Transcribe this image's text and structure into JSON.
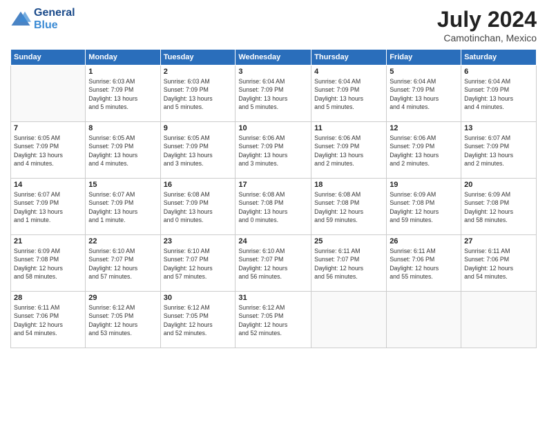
{
  "header": {
    "logo_line1": "General",
    "logo_line2": "Blue",
    "month_year": "July 2024",
    "location": "Camotinchan, Mexico"
  },
  "days_of_week": [
    "Sunday",
    "Monday",
    "Tuesday",
    "Wednesday",
    "Thursday",
    "Friday",
    "Saturday"
  ],
  "weeks": [
    [
      {
        "day": "",
        "info": ""
      },
      {
        "day": "1",
        "info": "Sunrise: 6:03 AM\nSunset: 7:09 PM\nDaylight: 13 hours\nand 5 minutes."
      },
      {
        "day": "2",
        "info": "Sunrise: 6:03 AM\nSunset: 7:09 PM\nDaylight: 13 hours\nand 5 minutes."
      },
      {
        "day": "3",
        "info": "Sunrise: 6:04 AM\nSunset: 7:09 PM\nDaylight: 13 hours\nand 5 minutes."
      },
      {
        "day": "4",
        "info": "Sunrise: 6:04 AM\nSunset: 7:09 PM\nDaylight: 13 hours\nand 5 minutes."
      },
      {
        "day": "5",
        "info": "Sunrise: 6:04 AM\nSunset: 7:09 PM\nDaylight: 13 hours\nand 4 minutes."
      },
      {
        "day": "6",
        "info": "Sunrise: 6:04 AM\nSunset: 7:09 PM\nDaylight: 13 hours\nand 4 minutes."
      }
    ],
    [
      {
        "day": "7",
        "info": "Sunrise: 6:05 AM\nSunset: 7:09 PM\nDaylight: 13 hours\nand 4 minutes."
      },
      {
        "day": "8",
        "info": "Sunrise: 6:05 AM\nSunset: 7:09 PM\nDaylight: 13 hours\nand 4 minutes."
      },
      {
        "day": "9",
        "info": "Sunrise: 6:05 AM\nSunset: 7:09 PM\nDaylight: 13 hours\nand 3 minutes."
      },
      {
        "day": "10",
        "info": "Sunrise: 6:06 AM\nSunset: 7:09 PM\nDaylight: 13 hours\nand 3 minutes."
      },
      {
        "day": "11",
        "info": "Sunrise: 6:06 AM\nSunset: 7:09 PM\nDaylight: 13 hours\nand 2 minutes."
      },
      {
        "day": "12",
        "info": "Sunrise: 6:06 AM\nSunset: 7:09 PM\nDaylight: 13 hours\nand 2 minutes."
      },
      {
        "day": "13",
        "info": "Sunrise: 6:07 AM\nSunset: 7:09 PM\nDaylight: 13 hours\nand 2 minutes."
      }
    ],
    [
      {
        "day": "14",
        "info": "Sunrise: 6:07 AM\nSunset: 7:09 PM\nDaylight: 13 hours\nand 1 minute."
      },
      {
        "day": "15",
        "info": "Sunrise: 6:07 AM\nSunset: 7:09 PM\nDaylight: 13 hours\nand 1 minute."
      },
      {
        "day": "16",
        "info": "Sunrise: 6:08 AM\nSunset: 7:09 PM\nDaylight: 13 hours\nand 0 minutes."
      },
      {
        "day": "17",
        "info": "Sunrise: 6:08 AM\nSunset: 7:08 PM\nDaylight: 13 hours\nand 0 minutes."
      },
      {
        "day": "18",
        "info": "Sunrise: 6:08 AM\nSunset: 7:08 PM\nDaylight: 12 hours\nand 59 minutes."
      },
      {
        "day": "19",
        "info": "Sunrise: 6:09 AM\nSunset: 7:08 PM\nDaylight: 12 hours\nand 59 minutes."
      },
      {
        "day": "20",
        "info": "Sunrise: 6:09 AM\nSunset: 7:08 PM\nDaylight: 12 hours\nand 58 minutes."
      }
    ],
    [
      {
        "day": "21",
        "info": "Sunrise: 6:09 AM\nSunset: 7:08 PM\nDaylight: 12 hours\nand 58 minutes."
      },
      {
        "day": "22",
        "info": "Sunrise: 6:10 AM\nSunset: 7:07 PM\nDaylight: 12 hours\nand 57 minutes."
      },
      {
        "day": "23",
        "info": "Sunrise: 6:10 AM\nSunset: 7:07 PM\nDaylight: 12 hours\nand 57 minutes."
      },
      {
        "day": "24",
        "info": "Sunrise: 6:10 AM\nSunset: 7:07 PM\nDaylight: 12 hours\nand 56 minutes."
      },
      {
        "day": "25",
        "info": "Sunrise: 6:11 AM\nSunset: 7:07 PM\nDaylight: 12 hours\nand 56 minutes."
      },
      {
        "day": "26",
        "info": "Sunrise: 6:11 AM\nSunset: 7:06 PM\nDaylight: 12 hours\nand 55 minutes."
      },
      {
        "day": "27",
        "info": "Sunrise: 6:11 AM\nSunset: 7:06 PM\nDaylight: 12 hours\nand 54 minutes."
      }
    ],
    [
      {
        "day": "28",
        "info": "Sunrise: 6:11 AM\nSunset: 7:06 PM\nDaylight: 12 hours\nand 54 minutes."
      },
      {
        "day": "29",
        "info": "Sunrise: 6:12 AM\nSunset: 7:05 PM\nDaylight: 12 hours\nand 53 minutes."
      },
      {
        "day": "30",
        "info": "Sunrise: 6:12 AM\nSunset: 7:05 PM\nDaylight: 12 hours\nand 52 minutes."
      },
      {
        "day": "31",
        "info": "Sunrise: 6:12 AM\nSunset: 7:05 PM\nDaylight: 12 hours\nand 52 minutes."
      },
      {
        "day": "",
        "info": ""
      },
      {
        "day": "",
        "info": ""
      },
      {
        "day": "",
        "info": ""
      }
    ]
  ]
}
